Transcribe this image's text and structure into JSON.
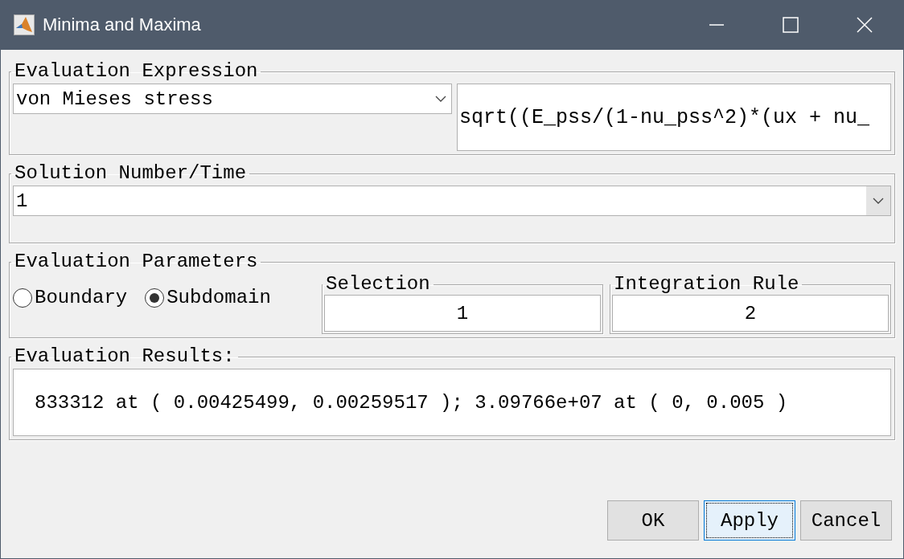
{
  "window": {
    "title": "Minima and Maxima"
  },
  "evaluation_expression": {
    "title": "Evaluation Expression",
    "dropdown_value": "von Mieses stress",
    "expression": "sqrt((E_pss/(1-nu_pss^2)*(ux + nu_"
  },
  "solution": {
    "title": "Solution Number/Time",
    "dropdown_value": "1"
  },
  "parameters": {
    "title": "Evaluation Parameters",
    "options": [
      {
        "label": "Boundary",
        "selected": false
      },
      {
        "label": "Subdomain",
        "selected": true
      }
    ],
    "selection": {
      "title": "Selection",
      "value": "1"
    },
    "integration_rule": {
      "title": "Integration Rule",
      "value": "2"
    }
  },
  "results": {
    "title": "Evaluation Results:",
    "value": "833312 at ( 0.00425499, 0.00259517 ); 3.09766e+07 at ( 0, 0.005 )"
  },
  "buttons": [
    {
      "label": "OK",
      "focused": false
    },
    {
      "label": "Apply",
      "focused": true
    },
    {
      "label": "Cancel",
      "focused": false
    }
  ]
}
